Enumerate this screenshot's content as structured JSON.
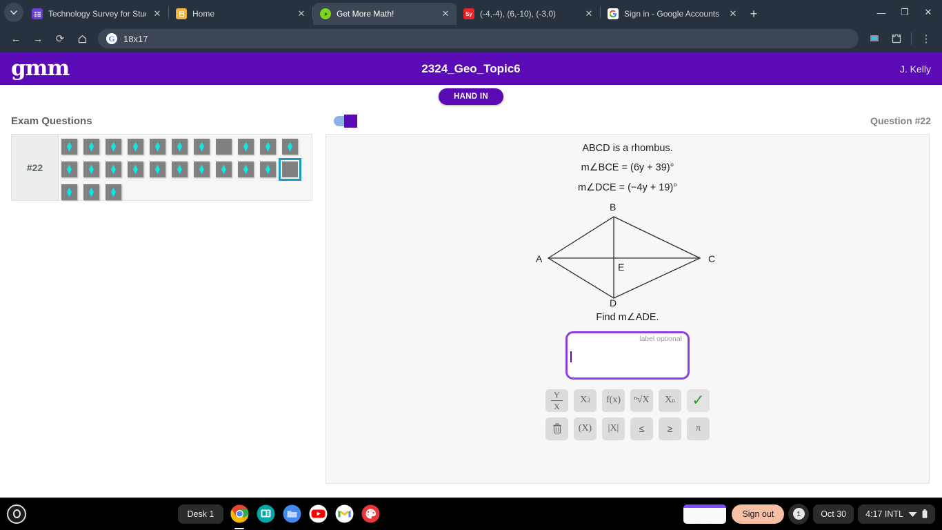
{
  "browser": {
    "tabs": [
      {
        "title": "Technology Survey for Students",
        "favicon": "list-purple-icon",
        "active": false
      },
      {
        "title": "Home",
        "favicon": "home-orange-icon",
        "active": false
      },
      {
        "title": "Get More Math!",
        "favicon": "gmm-green-icon",
        "active": true
      },
      {
        "title": "(-4,-4), (6,-10), (-3,0)",
        "favicon": "symbolab-icon",
        "active": false
      },
      {
        "title": "Sign in - Google Accounts",
        "favicon": "google-icon",
        "active": false
      }
    ],
    "newtab_label": "+",
    "window_controls": {
      "minimize": "—",
      "maximize": "❐",
      "close": "✕"
    },
    "toolbar": {
      "back": "←",
      "forward": "→",
      "reload": "⟳",
      "home": "⌂",
      "omnibox_value": "18x17",
      "omnibox_engine": "G",
      "share_icon": "cast-icon",
      "extensions_icon": "extensions-icon",
      "menu_icon": "⋮"
    }
  },
  "app": {
    "logo": "gmm",
    "title": "2324_Geo_Topic6",
    "user": "J. Kelly",
    "hand_in_label": "HAND IN",
    "accent_purple": "#5b0bb5"
  },
  "subbar": {
    "left_title": "Exam Questions",
    "right_title": "Question #22",
    "toggle_on": true
  },
  "navigator": {
    "label": "#22",
    "tiles": [
      {
        "filled": true
      },
      {
        "filled": true
      },
      {
        "filled": true
      },
      {
        "filled": true
      },
      {
        "filled": true
      },
      {
        "filled": true
      },
      {
        "filled": true
      },
      {
        "filled": false
      },
      {
        "filled": true
      },
      {
        "filled": true
      },
      {
        "filled": true
      },
      {
        "filled": true
      },
      {
        "filled": true
      },
      {
        "filled": true
      },
      {
        "filled": true
      },
      {
        "filled": true
      },
      {
        "filled": true
      },
      {
        "filled": true
      },
      {
        "filled": true
      },
      {
        "filled": true
      },
      {
        "filled": true
      },
      {
        "filled": false,
        "selected": true
      },
      {
        "filled": true
      },
      {
        "filled": true
      },
      {
        "filled": true
      }
    ],
    "tile_color": "#808080",
    "diamond_color": "#0ee6ef",
    "selected_outline": "#1a9bc4"
  },
  "question": {
    "stem_lines": [
      "ABCD is a rhombus.",
      "m∠BCE = (6y + 39)°",
      "m∠DCE = (−4y + 19)°"
    ],
    "diagram": {
      "vertex_a": "A",
      "vertex_b": "B",
      "vertex_c": "C",
      "vertex_d": "D",
      "vertex_e": "E"
    },
    "prompt": "Find m∠ADE.",
    "answer_value": "",
    "answer_hint": "label optional",
    "answer_border_color": "#8b3fe0"
  },
  "mathbar": {
    "row1": [
      {
        "name": "fraction-key",
        "num": "Y",
        "den": "X"
      },
      {
        "name": "square-key",
        "label": "X",
        "sup": "2"
      },
      {
        "name": "function-key",
        "label": "f(x)"
      },
      {
        "name": "nth-root-key",
        "label": "ⁿ√X"
      },
      {
        "name": "subscript-key",
        "label": "X",
        "sub": "n"
      },
      {
        "name": "submit-check-key",
        "label": "✓"
      }
    ],
    "row2": [
      {
        "name": "delete-key",
        "label": "🗑"
      },
      {
        "name": "parentheses-key",
        "label": "(X)"
      },
      {
        "name": "absolute-value-key",
        "label": "|X|"
      },
      {
        "name": "less-equal-key",
        "label": "≤"
      },
      {
        "name": "greater-equal-key",
        "label": "≥"
      },
      {
        "name": "pi-key",
        "label": "π"
      }
    ]
  },
  "shelf": {
    "desk_label": "Desk 1",
    "apps": [
      {
        "name": "chrome",
        "running": true
      },
      {
        "name": "google-play-store",
        "running": false
      },
      {
        "name": "files",
        "running": false
      },
      {
        "name": "youtube",
        "running": false
      },
      {
        "name": "gmail",
        "running": false
      },
      {
        "name": "art-palette",
        "running": false
      }
    ],
    "sign_out_label": "Sign out",
    "notification_count": "1",
    "date": "Oct 30",
    "time": "4:17 INTL"
  }
}
